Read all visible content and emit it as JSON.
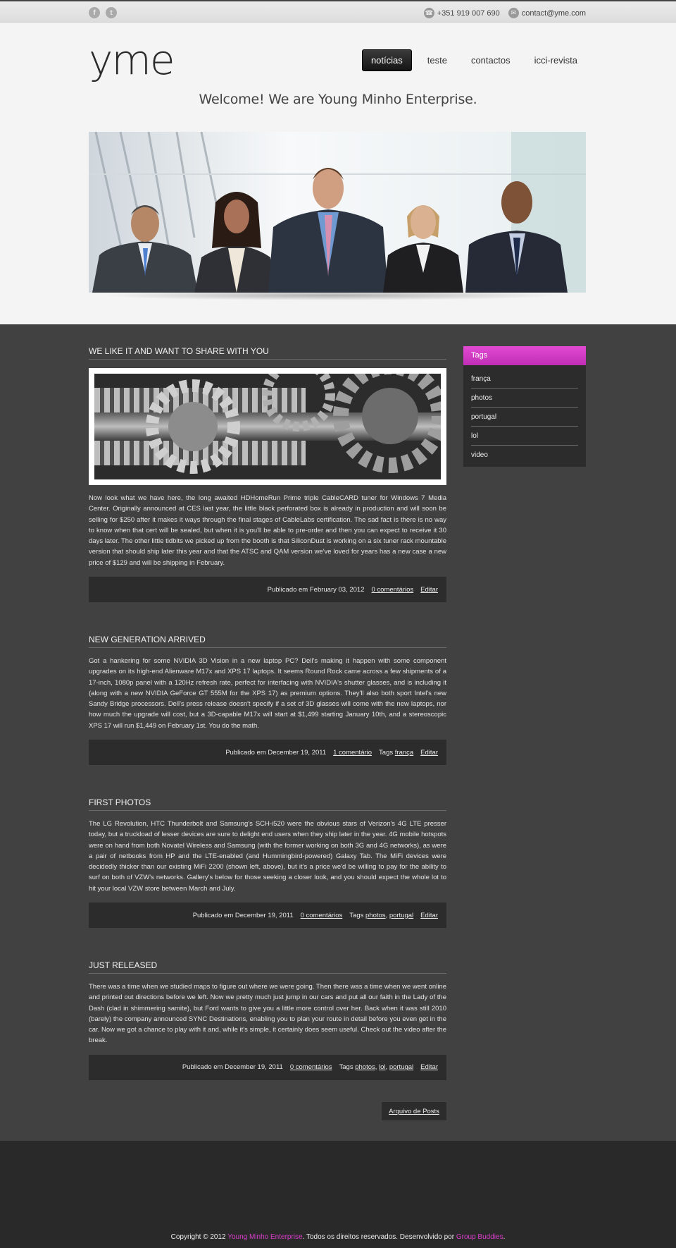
{
  "topbar": {
    "social": [
      {
        "icon": "facebook-icon",
        "glyph": "f"
      },
      {
        "icon": "twitter-icon",
        "glyph": "t"
      }
    ],
    "phone": "+351 919 007 690",
    "email": "contact@yme.com"
  },
  "header": {
    "logo": "yme",
    "nav": [
      {
        "label": "notícias",
        "active": true
      },
      {
        "label": "teste",
        "active": false
      },
      {
        "label": "contactos",
        "active": false
      },
      {
        "label": "icci-revista",
        "active": false
      }
    ],
    "welcome": "Welcome! We are Young Minho Enterprise."
  },
  "posts": [
    {
      "title": "WE LIKE IT AND WANT TO SHARE WITH YOU",
      "body": "Now look what we have here, the long awaited HDHomeRun Prime triple CableCARD tuner for Windows 7 Media Center. Originally announced at CES last year, the little black perforated box is already in production and will soon be selling for $250 after it makes it ways through the final stages of CableLabs certification. The sad fact is there is no way to know when that cert will be sealed, but when it is you'll be able to pre-order and then you can expect to receive it 30 days later. The other little tidbits we picked up from the booth is that SiliconDust is working on a six tuner rack mountable version that should ship later this year and that the ATSC and QAM version we've loved for years has a new case a new price of $129 and will be shipping in February.",
      "published": "Publicado em February 03, 2012",
      "comments": "0 comentários",
      "tags_label": "",
      "tags": [],
      "edit": "Editar"
    },
    {
      "title": "NEW GENERATION ARRIVED",
      "body": "Got a hankering for some NVIDIA 3D Vision in a new laptop PC? Dell's making it happen with some component upgrades on its high-end Alienware M17x and XPS 17 laptops. It seems Round Rock came across a few shipments of a 17-inch, 1080p panel with a 120Hz refresh rate, perfect for interfacing with NVIDIA's shutter glasses, and is including it (along with a new NVIDIA GeForce GT 555M for the XPS 17) as premium options. They'll also both sport Intel's new Sandy Bridge processors. Dell's press release doesn't specify if a set of 3D glasses will come with the new laptops, nor how much the upgrade will cost, but a 3D-capable M17x will start at $1,499 starting January 10th, and a stereoscopic XPS 17 will run $1,449 on February 1st. You do the math.",
      "published": "Publicado em December 19, 2011",
      "comments": "1 comentário",
      "tags_label": "Tags",
      "tags": [
        "frança"
      ],
      "edit": "Editar"
    },
    {
      "title": "FIRST PHOTOS",
      "body": "The LG Revolution, HTC Thunderbolt and Samsung's SCH-i520 were the obvious stars of Verizon's 4G LTE presser today, but a truckload of lesser devices are sure to delight end users when they ship later in the year. 4G mobile hotspots were on hand from both Novatel Wireless and Samsung (with the former working on both 3G and 4G networks), as were a pair of netbooks from HP and the LTE-enabled (and Hummingbird-powered) Galaxy Tab. The MiFi devices were decidedly thicker than our existing MiFi 2200 (shown left, above), but it's a price we'd be willing to pay for the ability to surf on both of VZW's networks. Gallery's below for those seeking a closer look, and you should expect the whole lot to hit your local VZW store between March and July.",
      "published": "Publicado em December 19, 2011",
      "comments": "0 comentários",
      "tags_label": "Tags",
      "tags": [
        "photos",
        "portugal"
      ],
      "edit": "Editar"
    },
    {
      "title": "JUST RELEASED",
      "body": "There was a time when we studied maps to figure out where we were going. Then there was a time when we went online and printed out directions before we left. Now we pretty much just jump in our cars and put all our faith in the Lady of the Dash (clad in shimmering samite), but Ford wants to give you a little more control over her. Back when it was still 2010 (barely) the company announced SYNC Destinations, enabling you to plan your route in detail before you even get in the car. Now we got a chance to play with it and, while it's simple, it certainly does seem useful. Check out the video after the break.",
      "published": "Publicado em December 19, 2011",
      "comments": "0 comentários",
      "tags_label": "Tags",
      "tags": [
        "photos",
        "lol",
        "portugal"
      ],
      "edit": "Editar"
    }
  ],
  "sidebar": {
    "title": "Tags",
    "tags": [
      "frança",
      "photos",
      "portugal",
      "lol",
      "video"
    ]
  },
  "archive_link": "Arquivo de Posts",
  "footer": {
    "prefix": "Copyright © 2012 ",
    "company": "Young Minho Enterprise",
    "middle": ". Todos os direitos reservados. Desenvolvido por ",
    "dev": "Group Buddies",
    "suffix": "."
  },
  "colors": {
    "accent": "#d93dca",
    "content_bg": "#414141",
    "header_bg": "#f4f4f4"
  }
}
